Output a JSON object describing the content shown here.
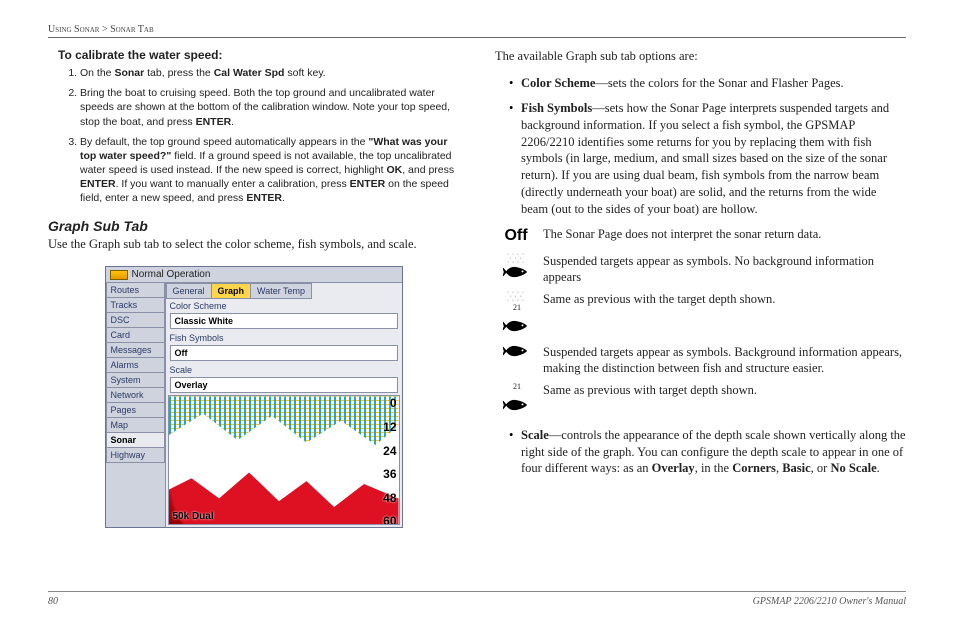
{
  "breadcrumb": {
    "pre": "Using Sonar",
    "sep": " > ",
    "post": "Sonar Tab"
  },
  "left": {
    "calib_heading": "To calibrate the water speed:",
    "steps": [
      "On the <b>Sonar</b> tab, press the <b>Cal Water Spd</b> soft key.",
      "Bring the boat to cruising speed. Both the top ground and uncalibrated water speeds are shown at the bottom of the calibration window. Note your top speed, stop the boat, and press <b>ENTER</b>.",
      "By default, the top ground speed automatically appears in the <b>\"What was your top water speed?\"</b> field. If a ground speed is not available, the top uncalibrated water speed is used instead. If the new speed is correct, highlight <b>OK</b>, and press <b>ENTER</b>. If you want to manually enter a calibration, press <b>ENTER</b> on the speed field, enter a new speed, and press <b>ENTER</b>."
    ],
    "subhead": "Graph Sub Tab",
    "subpara": "Use the Graph sub tab to select the color scheme, fish symbols, and scale.",
    "shot": {
      "title": "Normal Operation",
      "side": [
        "Routes",
        "Tracks",
        "DSC",
        "Card",
        "Messages",
        "Alarms",
        "System",
        "Network",
        "Pages",
        "Map",
        "Sonar",
        "Highway"
      ],
      "side_selected": "Sonar",
      "subtabs": [
        "General",
        "Graph",
        "Water Temp"
      ],
      "subtab_selected": "Graph",
      "fields": [
        {
          "label": "Color Scheme",
          "value": "Classic White"
        },
        {
          "label": "Fish Symbols",
          "value": "Off"
        },
        {
          "label": "Scale",
          "value": "Overlay"
        }
      ],
      "depths": [
        "0",
        "12",
        "24",
        "36",
        "48",
        "60"
      ],
      "bottom": "50k\nDual"
    }
  },
  "right": {
    "intro": "The available Graph sub tab options are:",
    "opts": [
      "<b>Color Scheme</b>—sets the colors for the Sonar and Flasher Pages.",
      "<b>Fish Symbols</b>—sets how the Sonar Page interprets suspended targets and background information. If you select a fish symbol, the GPSMAP 2206/2210 identifies some returns for you by replacing them with fish symbols (in large, medium, and small sizes based on the size of the sonar return). If you are using dual beam, fish symbols from the narrow beam (directly underneath your boat) are solid, and the returns from the wide beam (out to the sides of your boat) are hollow."
    ],
    "icons": [
      {
        "kind": "off",
        "text": "The Sonar Page does not interpret the sonar return data."
      },
      {
        "kind": "fish-dots",
        "text": "Suspended targets appear as symbols. No background information appears"
      },
      {
        "kind": "fish-dots-depth",
        "text": "Same as previous with the target depth shown."
      },
      {
        "kind": "fish-solid",
        "text": "Suspended targets appear as symbols. Background information appears, making the distinction between fish and structure easier."
      },
      {
        "kind": "fish-solid-depth",
        "text": "Same as previous with target depth shown."
      }
    ],
    "opts2": [
      "<b>Scale</b>—controls the appearance of the depth scale shown vertically along the right side of the graph. You can configure the depth scale to appear in one of four different ways: as an <b>Overlay</b>, in the <b>Corners</b>, <b>Basic</b>, or <b>No Scale</b>."
    ]
  },
  "footer": {
    "page": "80",
    "manual": "GPSMAP 2206/2210 Owner's Manual"
  }
}
